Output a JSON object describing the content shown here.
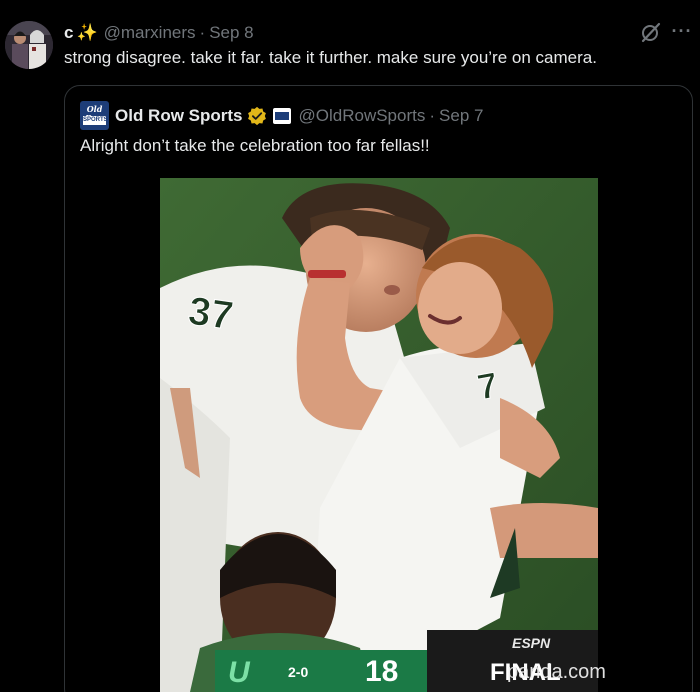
{
  "author": {
    "display_name": "c",
    "emoji": "✨",
    "handle": "@marxiners",
    "separator": "·",
    "date": "Sep 8",
    "avatar_icon": "profile-avatar"
  },
  "tweet": {
    "text": "strong disagree. take it far. take it further. make sure you’re on camera."
  },
  "actions": {
    "grok_icon": "grok-icon",
    "more_label": "···"
  },
  "quoted_tweet": {
    "display_name": "Old Row Sports",
    "handle": "@OldRowSports",
    "separator": "·",
    "date": "Sep 7",
    "text": "Alright don’t take the celebration too far fellas!!",
    "logo": {
      "line1": "Old Row",
      "line2": "SPORTS"
    },
    "verified_color": "#e2b719",
    "media": {
      "jersey_left": "37",
      "jersey_right": "7",
      "scorebug": {
        "network": "ESPN",
        "record": "2-0",
        "score": "18",
        "status": "FINAL"
      }
    }
  },
  "watermark": "pandа.com"
}
